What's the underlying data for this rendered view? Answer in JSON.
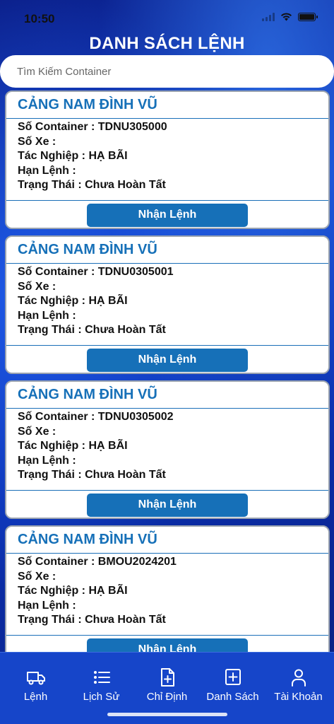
{
  "status": {
    "time": "10:50"
  },
  "header": {
    "title": "DANH SÁCH LỆNH"
  },
  "search": {
    "placeholder": "Tìm Kiếm Container"
  },
  "orders": [
    {
      "port": "CẢNG NAM ĐÌNH VŨ",
      "container": "Số Container : TDNU305000",
      "vehicle": "Số Xe :",
      "operation": "Tác Nghiệp : HẠ BÃI",
      "deadline": "Hạn Lệnh :",
      "status": "Trạng Thái : Chưa Hoàn Tất",
      "action": "Nhận Lệnh"
    },
    {
      "port": "CẢNG NAM ĐÌNH VŨ",
      "container": "Số Container : TDNU0305001",
      "vehicle": "Số Xe :",
      "operation": "Tác Nghiệp : HẠ BÃI",
      "deadline": "Hạn Lệnh :",
      "status": "Trạng Thái : Chưa Hoàn Tất",
      "action": "Nhận Lệnh"
    },
    {
      "port": "CẢNG NAM ĐÌNH VŨ",
      "container": "Số Container : TDNU0305002",
      "vehicle": "Số Xe :",
      "operation": "Tác Nghiệp : HẠ BÃI",
      "deadline": "Hạn Lệnh :",
      "status": "Trạng Thái : Chưa Hoàn Tất",
      "action": "Nhận Lệnh"
    },
    {
      "port": "CẢNG NAM ĐÌNH VŨ",
      "container": "Số Container : BMOU2024201",
      "vehicle": "Số Xe :",
      "operation": "Tác Nghiệp : HẠ BÃI",
      "deadline": "Hạn Lệnh :",
      "status": "Trạng Thái : Chưa Hoàn Tất",
      "action": "Nhận Lệnh"
    }
  ],
  "tabs": [
    {
      "label": "Lệnh",
      "icon": "truck-icon"
    },
    {
      "label": "Lịch Sử",
      "icon": "list-icon"
    },
    {
      "label": "Chỉ Định",
      "icon": "document-add-icon"
    },
    {
      "label": "Danh Sách",
      "icon": "plus-square-icon"
    },
    {
      "label": "Tài Khoản",
      "icon": "user-icon"
    }
  ],
  "colors": {
    "accent": "#1670b8",
    "tabbar": "#1645c9",
    "background": "#0a2a9c"
  }
}
